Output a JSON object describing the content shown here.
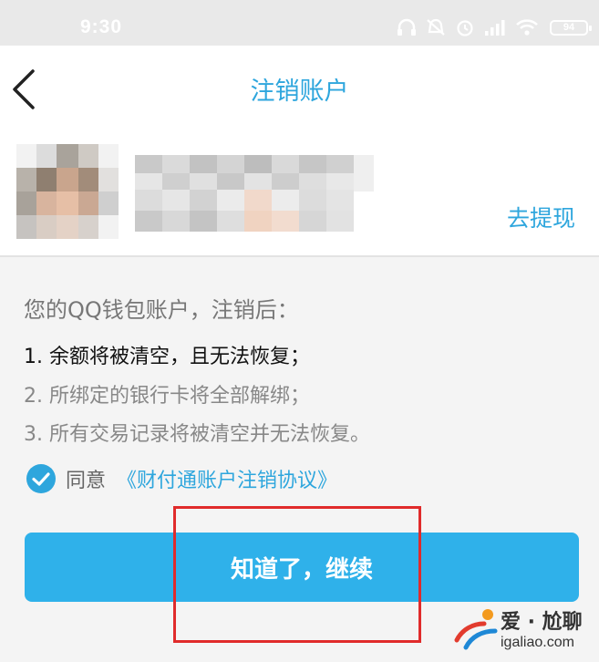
{
  "status_bar": {
    "time": "9:30",
    "battery": "94"
  },
  "nav": {
    "title": "注销账户"
  },
  "account": {
    "withdraw_label": "去提现"
  },
  "notice": {
    "heading": "您的QQ钱包账户，注销后：",
    "items": [
      "1. 余额将被清空，且无法恢复；",
      "2. 所绑定的银行卡将全部解绑；",
      "3. 所有交易记录将被清空并无法恢复。"
    ]
  },
  "agreement": {
    "label": "同意",
    "link": "《财付通账户注销协议》",
    "checked": true
  },
  "continue_button": {
    "label": "知道了，继续"
  },
  "watermark": {
    "text": "爱 · 尬聊",
    "domain": "igaliao.com"
  },
  "colors": {
    "accent": "#2ea6dd",
    "button": "#2fb1ea",
    "highlight": "#e02b2b"
  }
}
